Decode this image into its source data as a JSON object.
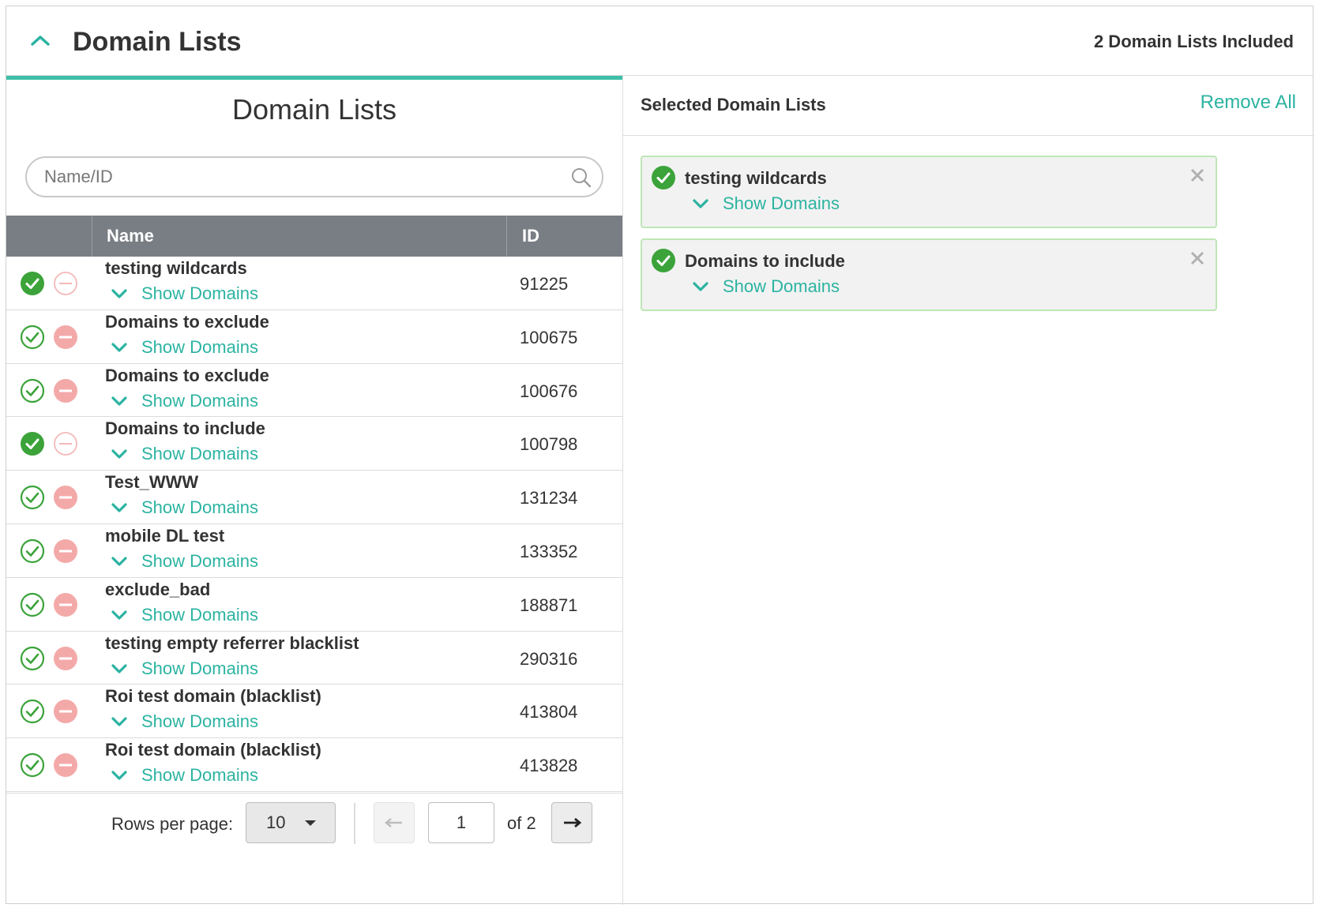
{
  "header": {
    "title": "Domain Lists",
    "included_count": "2 Domain Lists Included"
  },
  "left": {
    "title": "Domain Lists",
    "search": {
      "placeholder": "Name/ID",
      "value": ""
    },
    "columns": {
      "name": "Name",
      "id": "ID"
    },
    "show_domains_label": "Show Domains",
    "rows": [
      {
        "name": "testing wildcards",
        "id": "91225",
        "included": true
      },
      {
        "name": "Domains to exclude",
        "id": "100675",
        "included": false
      },
      {
        "name": "Domains to exclude",
        "id": "100676",
        "included": false
      },
      {
        "name": "Domains to include",
        "id": "100798",
        "included": true
      },
      {
        "name": "Test_WWW",
        "id": "131234",
        "included": false
      },
      {
        "name": "mobile DL test",
        "id": "133352",
        "included": false
      },
      {
        "name": "exclude_bad",
        "id": "188871",
        "included": false
      },
      {
        "name": "testing empty referrer blacklist",
        "id": "290316",
        "included": false
      },
      {
        "name": "Roi test domain (blacklist)",
        "id": "413804",
        "included": false
      },
      {
        "name": "Roi test domain (blacklist)",
        "id": "413828",
        "included": false
      }
    ],
    "pager": {
      "rows_label": "Rows per page:",
      "rows_value": "10",
      "page": "1",
      "of_label": "of 2"
    }
  },
  "right": {
    "title": "Selected Domain Lists",
    "remove_all": "Remove All",
    "show_domains_label": "Show Domains",
    "selected": [
      {
        "name": "testing wildcards"
      },
      {
        "name": "Domains to include"
      }
    ]
  },
  "colors": {
    "accent": "#2bb3a1",
    "include_green": "#3ba33a",
    "exclude_pink": "#f4a9a9",
    "table_header": "#797e84"
  }
}
